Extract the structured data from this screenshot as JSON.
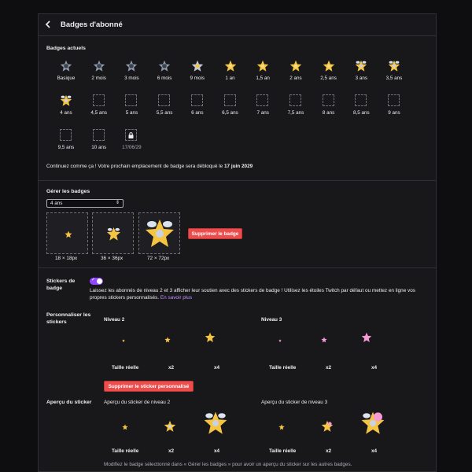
{
  "header": {
    "back_icon": "chevron-left-icon",
    "title": "Badges d'abonné"
  },
  "current": {
    "title": "Badges actuels",
    "badges": [
      {
        "label": "Basique",
        "kind": "gray-star"
      },
      {
        "label": "2 mois",
        "kind": "gray-star"
      },
      {
        "label": "3 mois",
        "kind": "gray-star"
      },
      {
        "label": "6 mois",
        "kind": "gray-star"
      },
      {
        "label": "9 mois",
        "kind": "silver-star"
      },
      {
        "label": "1 an",
        "kind": "gold-star"
      },
      {
        "label": "1,5 an",
        "kind": "gold-star"
      },
      {
        "label": "2 ans",
        "kind": "gold-star"
      },
      {
        "label": "2,5 ans",
        "kind": "gold-star"
      },
      {
        "label": "3 ans",
        "kind": "gold-winged"
      },
      {
        "label": "3,5 ans",
        "kind": "gold-winged"
      },
      {
        "label": "4 ans",
        "kind": "gold-winged"
      },
      {
        "label": "4,5 ans",
        "kind": "empty"
      },
      {
        "label": "5 ans",
        "kind": "empty"
      },
      {
        "label": "5,5 ans",
        "kind": "empty"
      },
      {
        "label": "6 ans",
        "kind": "empty"
      },
      {
        "label": "6,5 ans",
        "kind": "empty"
      },
      {
        "label": "7 ans",
        "kind": "empty"
      },
      {
        "label": "7,5 ans",
        "kind": "empty"
      },
      {
        "label": "8 ans",
        "kind": "empty"
      },
      {
        "label": "8,5 ans",
        "kind": "empty"
      },
      {
        "label": "9 ans",
        "kind": "empty"
      },
      {
        "label": "9,5 ans",
        "kind": "empty"
      },
      {
        "label": "10 ans",
        "kind": "empty"
      },
      {
        "label": "17/06/29",
        "kind": "locked"
      }
    ],
    "message_prefix": "Continuez comme ça ! Votre prochain emplacement de badge sera débloqué le ",
    "message_date": "17 juin 2029"
  },
  "manage": {
    "title": "Gérer les badges",
    "selected": "4 ans",
    "previews": [
      "18 × 18px",
      "36 × 36px",
      "72 × 72px"
    ],
    "delete_button": "Supprimer le badge"
  },
  "stickers": {
    "title": "Stickers de badge",
    "toggle_on": true,
    "description": "Laissez les abonnés de niveau 2 et 3 afficher leur soutien avec des stickers de badge ! Utilisez les étoiles Twitch par défaut ou mettez en ligne vos propres stickers personnalisés.",
    "learn_more": "En savoir plus",
    "customize_title": "Personnaliser les stickers",
    "level2": "Niveau 2",
    "level3": "Niveau 3",
    "sizes": [
      "Taille réelle",
      "x2",
      "x4"
    ],
    "delete_custom": "Supprimer le sticker personnalisé",
    "preview_title": "Aperçu du sticker",
    "preview_l2": "Aperçu du sticker de niveau 2",
    "preview_l3": "Aperçu du sticker de niveau 3",
    "footer": "Modifiez le badge sélectionné dans « Gérer les badges » pour avoir un aperçu du sticker sur les autres badges."
  },
  "colors": {
    "accent": "#9147ff",
    "danger": "#eb4c4c",
    "gold": "#f5c542",
    "link": "#bf94ff"
  }
}
